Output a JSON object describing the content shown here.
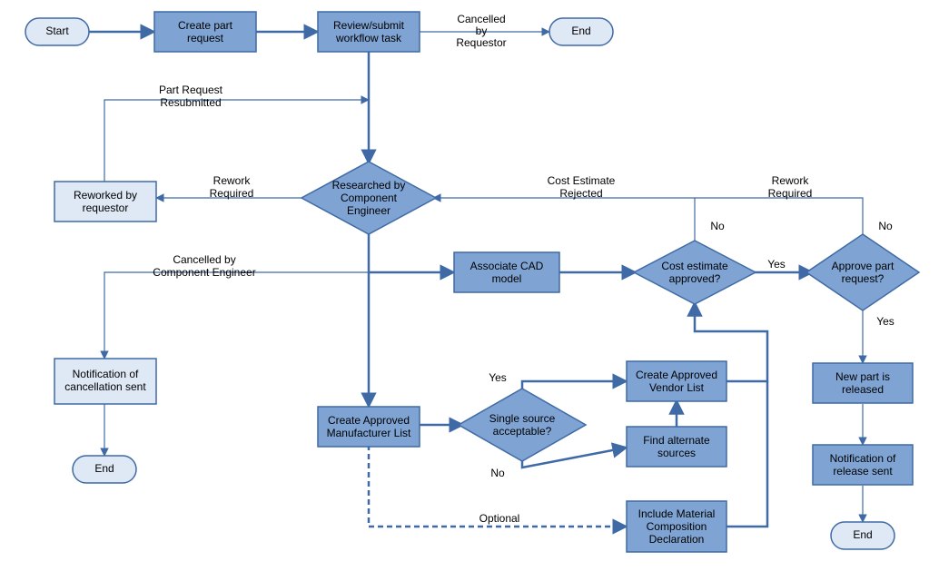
{
  "nodes": {
    "start": "Start",
    "create_request": "Create part\nrequest",
    "review_submit": "Review/submit\nworkflow task",
    "end_top": "End",
    "reworked": "Reworked by\nrequestor",
    "researched": "Researched by\nComponent\nEngineer",
    "notify_cancel": "Notification of\ncancellation sent",
    "end_cancel": "End",
    "associate_cad": "Associate CAD\nmodel",
    "cost_approved": "Cost estimate\napproved?",
    "approve_part": "Approve part\nrequest?",
    "create_aml": "Create Approved\nManufacturer List",
    "single_source": "Single source\nacceptable?",
    "create_avl": "Create Approved\nVendor List",
    "alt_sources": "Find alternate\nsources",
    "material_decl": "Include Material\nComposition\nDeclaration",
    "new_part": "New part is\nreleased",
    "notify_release": "Notification of\nrelease sent",
    "end_release": "End"
  },
  "labels": {
    "cancelled_req": "Cancelled\nby\nRequestor",
    "part_resubmit": "Part Request\nResubmitted",
    "rework_required_left": "Rework\nRequired",
    "cancelled_ce": "Cancelled by\nComponent Engineer",
    "yes_top": "Yes",
    "no": "No",
    "optional": "Optional",
    "cost_rejected": "Cost Estimate\nRejected",
    "rework_required_right": "Rework\nRequired",
    "yes_cost": "Yes",
    "no_cost": "No",
    "yes_appr": "Yes",
    "no_appr": "No"
  }
}
